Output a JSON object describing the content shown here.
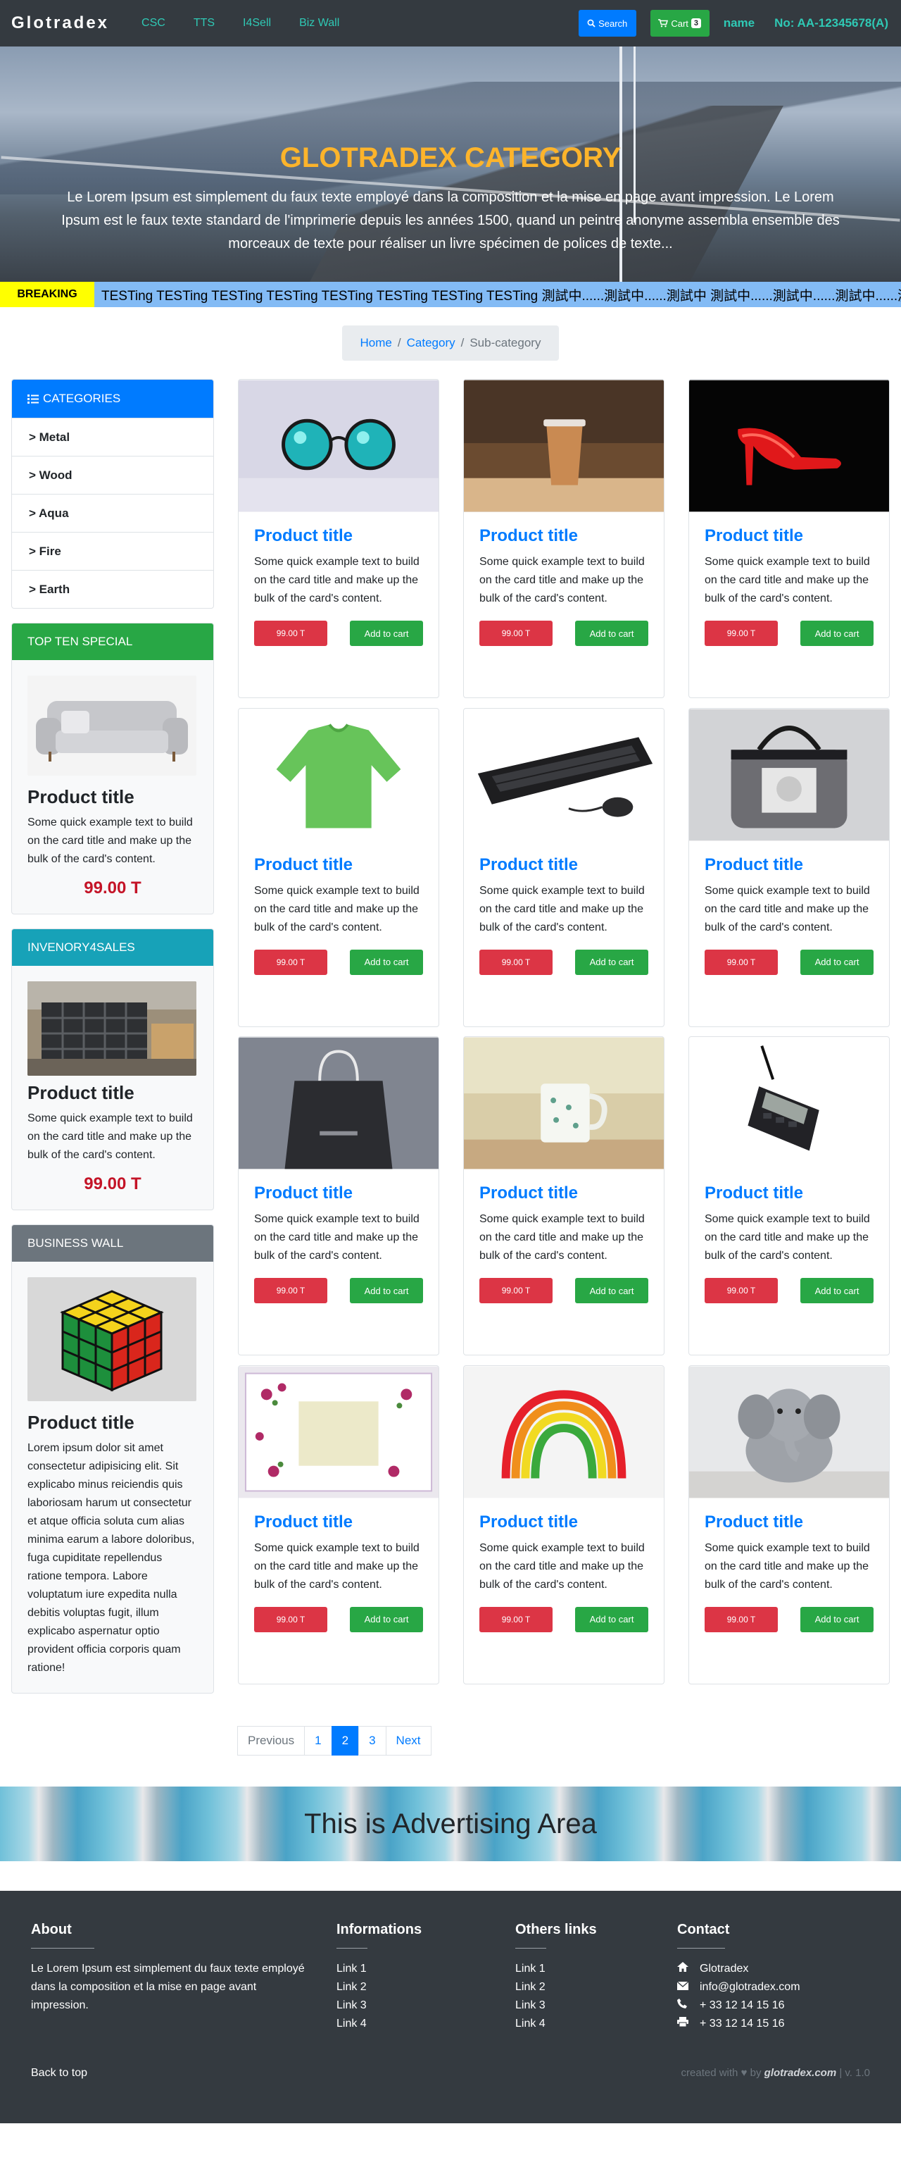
{
  "navbar": {
    "brand": "Glotradex",
    "links": [
      "CSC",
      "TTS",
      "I4Sell",
      "Biz Wall"
    ],
    "search_label": "Search",
    "cart_label": "Cart",
    "cart_count": "3",
    "user_name": "name",
    "user_no": "No: AA-12345678(A)"
  },
  "hero": {
    "title": "GLOTRADEX CATEGORY",
    "text": "Le Lorem Ipsum est simplement du faux texte employé dans la composition et la mise en page avant impression. Le Lorem Ipsum est le faux texte standard de l'imprimerie depuis les années 1500, quand un peintre anonyme assembla ensemble des morceaux de texte pour réaliser un livre spécimen de polices de texte..."
  },
  "ticker": {
    "label": "BREAKING",
    "text": "TESTing TESTing TESTing TESTing TESTing TESTing TESTing TESTing 測試中......測試中......測試中 測試中......測試中......測試中......測試中"
  },
  "breadcrumb": {
    "home": "Home",
    "category": "Category",
    "current": "Sub-category"
  },
  "categories": {
    "header": "CATEGORIES",
    "items": [
      "> Metal",
      "> Wood",
      "> Aqua",
      "> Fire",
      "> Earth"
    ]
  },
  "top_ten": {
    "header": "TOP TEN SPECIAL",
    "title": "Product title",
    "text": "Some quick example text to build on the card title and make up the bulk of the card's content.",
    "price": "99.00 T"
  },
  "inventory": {
    "header": "INVENORY4SALES",
    "title": "Product title",
    "text": "Some quick example text to build on the card title and make up the bulk of the card's content.",
    "price": "99.00 T"
  },
  "business_wall": {
    "header": "BUSINESS WALL",
    "title": "Product title",
    "text": "Lorem ipsum dolor sit amet consectetur adipisicing elit. Sit explicabo minus reiciendis quis laboriosam harum ut consectetur et atque officia soluta cum alias minima earum a labore doloribus, fuga cupiditate repellendus ratione tempora. Labore voluptatum iure expedita nulla debitis voluptas fugit, illum explicabo aspernatur optio provident officia corporis quam ratione!"
  },
  "products": [
    {
      "title": "Product title",
      "text": "Some quick example text to build on the card title and make up the bulk of the card's content.",
      "price": "99.00 T",
      "add": "Add to cart",
      "icon": "sunglasses-icon"
    },
    {
      "title": "Product title",
      "text": "Some quick example text to build on the card title and make up the bulk of the card's content.",
      "price": "99.00 T",
      "add": "Add to cart",
      "icon": "coffee-cup-icon"
    },
    {
      "title": "Product title",
      "text": "Some quick example text to build on the card title and make up the bulk of the card's content.",
      "price": "99.00 T",
      "add": "Add to cart",
      "icon": "high-heel-icon"
    },
    {
      "title": "Product title",
      "text": "Some quick example text to build on the card title and make up the bulk of the card's content.",
      "price": "99.00 T",
      "add": "Add to cart",
      "icon": "shirt-icon"
    },
    {
      "title": "Product title",
      "text": "Some quick example text to build on the card title and make up the bulk of the card's content.",
      "price": "99.00 T",
      "add": "Add to cart",
      "icon": "keyboard-icon"
    },
    {
      "title": "Product title",
      "text": "Some quick example text to build on the card title and make up the bulk of the card's content.",
      "price": "99.00 T",
      "add": "Add to cart",
      "icon": "handbag-icon"
    },
    {
      "title": "Product title",
      "text": "Some quick example text to build on the card title and make up the bulk of the card's content.",
      "price": "99.00 T",
      "add": "Add to cart",
      "icon": "shopping-bag-icon"
    },
    {
      "title": "Product title",
      "text": "Some quick example text to build on the card title and make up the bulk of the card's content.",
      "price": "99.00 T",
      "add": "Add to cart",
      "icon": "mug-icon"
    },
    {
      "title": "Product title",
      "text": "Some quick example text to build on the card title and make up the bulk of the card's content.",
      "price": "99.00 T",
      "add": "Add to cart",
      "icon": "pos-terminal-icon"
    },
    {
      "title": "Product title",
      "text": "Some quick example text to build on the card title and make up the bulk of the card's content.",
      "price": "99.00 T",
      "add": "Add to cart",
      "icon": "photo-frame-icon"
    },
    {
      "title": "Product title",
      "text": "Some quick example text to build on the card title and make up the bulk of the card's content.",
      "price": "99.00 T",
      "add": "Add to cart",
      "icon": "slinky-icon"
    },
    {
      "title": "Product title",
      "text": "Some quick example text to build on the card title and make up the bulk of the card's content.",
      "price": "99.00 T",
      "add": "Add to cart",
      "icon": "elephant-plush-icon"
    }
  ],
  "pagination": {
    "prev": "Previous",
    "pages": [
      "1",
      "2",
      "3"
    ],
    "next": "Next",
    "active": "2"
  },
  "ad": {
    "title": "This is Advertising Area"
  },
  "footer": {
    "about_title": "About",
    "about_text": "Le Lorem Ipsum est simplement du faux texte employé dans la composition et la mise en page avant impression.",
    "info_title": "Informations",
    "info_links": [
      "Link 1",
      "Link 2",
      "Link 3",
      "Link 4"
    ],
    "others_title": "Others links",
    "others_links": [
      "Link 1",
      "Link 2",
      "Link 3",
      "Link 4"
    ],
    "contact_title": "Contact",
    "contact_company": "Glotradex",
    "contact_email": "info@glotradex.com",
    "contact_phone": "+ 33 12 14 15 16",
    "contact_fax": "+ 33 12 14 15 16",
    "back_to_top": "Back to top",
    "credit_prefix": "created with",
    "credit_by": "by",
    "credit_site": "glotradex.com",
    "version": "| v. 1.0"
  },
  "colors": {
    "primary": "#007bff",
    "success": "#28a745",
    "info": "#17a2b8",
    "secondary": "#6c757d",
    "danger": "#dc3545",
    "dark": "#343a40",
    "hero_title": "#fdb42b",
    "ticker_label": "#ffff00",
    "ticker_body": "#83bbf5",
    "nav_link": "#2fc9b5"
  }
}
